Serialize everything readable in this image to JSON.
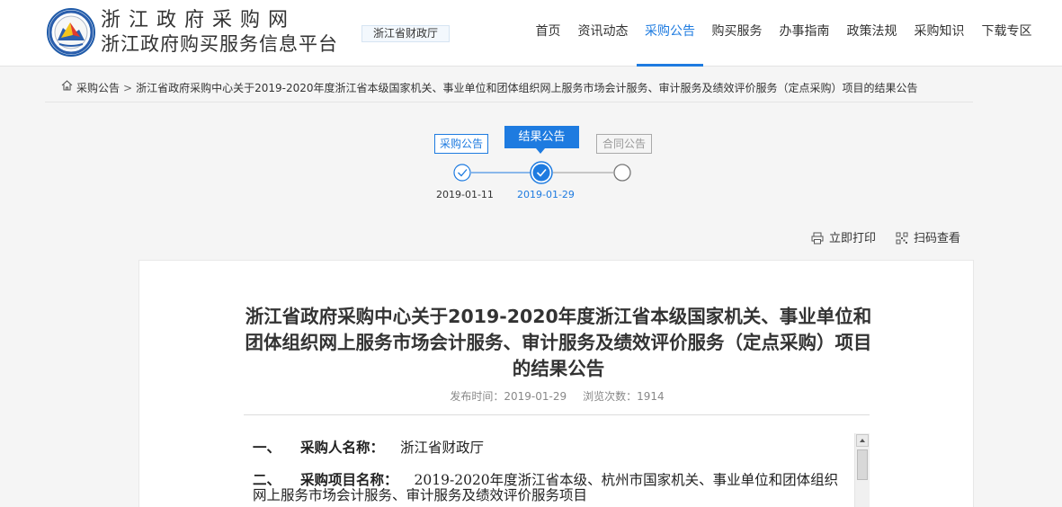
{
  "header": {
    "site_title": "浙江政府采购网",
    "site_subtitle": "浙江政府购买服务信息平台",
    "region": "浙江省财政厅",
    "logo_icon": "zhejiang-procurement-logo",
    "nav": [
      {
        "label": "首页",
        "active": false
      },
      {
        "label": "资讯动态",
        "active": false
      },
      {
        "label": "采购公告",
        "active": true
      },
      {
        "label": "购买服务",
        "active": false
      },
      {
        "label": "办事指南",
        "active": false
      },
      {
        "label": "政策法规",
        "active": false
      },
      {
        "label": "采购知识",
        "active": false
      },
      {
        "label": "下载专区",
        "active": false
      }
    ],
    "accent_color": "#1e7be0"
  },
  "breadcrumb": {
    "home_icon": "home-icon",
    "root": "采购公告",
    "separator": ">",
    "current": "浙江省政府采购中心关于2019-2020年度浙江省本级国家机关、事业单位和团体组织网上服务市场会计服务、审计服务及绩效评价服务（定点采购）项目的结果公告"
  },
  "stepper": {
    "steps": [
      {
        "label": "采购公告",
        "date": "2019-01-11",
        "state": "done"
      },
      {
        "label": "结果公告",
        "date": "2019-01-29",
        "state": "current"
      },
      {
        "label": "合同公告",
        "date": "",
        "state": "pending"
      }
    ]
  },
  "tools": {
    "print": "立即打印",
    "print_icon": "printer-icon",
    "scan": "扫码查看",
    "scan_icon": "qrcode-icon"
  },
  "article": {
    "title": "浙江省政府采购中心关于2019-2020年度浙江省本级国家机关、事业单位和团体组织网上服务市场会计服务、审计服务及绩效评价服务（定点采购）项目的结果公告",
    "publish_label": "发布时间：",
    "publish_date": "2019-01-29",
    "views_label": "浏览次数：",
    "views": "1914",
    "sections": [
      {
        "num": "一、",
        "label": "采购人名称：",
        "value": "浙江省财政厅"
      },
      {
        "num": "二、",
        "label": "采购项目名称：",
        "value": "2019-2020年度浙江省本级、杭州市国家机关、事业单位和团体组织网上服务市场会计服务、审计服务及绩效评价服务项目"
      }
    ]
  }
}
